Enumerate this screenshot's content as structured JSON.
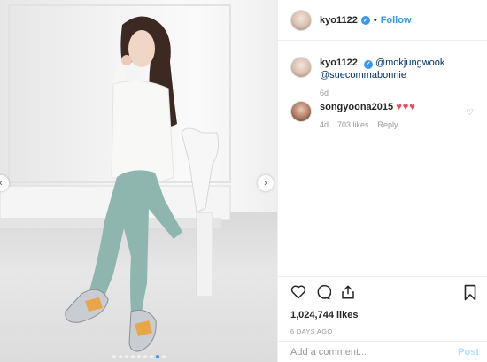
{
  "header": {
    "username": "kyo1122",
    "separator": "•",
    "follow_label": "Follow"
  },
  "caption": {
    "username": "kyo1122",
    "mention_1": "@mokjungwook",
    "mention_2": "@suecommabonnie",
    "age": "6d"
  },
  "comment": {
    "username": "songyoona2015",
    "hearts": "♥♥♥",
    "age": "4d",
    "likes": "703 likes",
    "reply_label": "Reply"
  },
  "post": {
    "likes": "1,024,744 likes",
    "date": "6 DAYS AGO"
  },
  "add_comment": {
    "placeholder": "Add a comment...",
    "post_label": "Post"
  },
  "colors": {
    "accent": "#3897f0",
    "heart": "#ed4956",
    "muted": "#999999"
  },
  "carousel": {
    "total_slides": 9,
    "active_slide": 7
  }
}
